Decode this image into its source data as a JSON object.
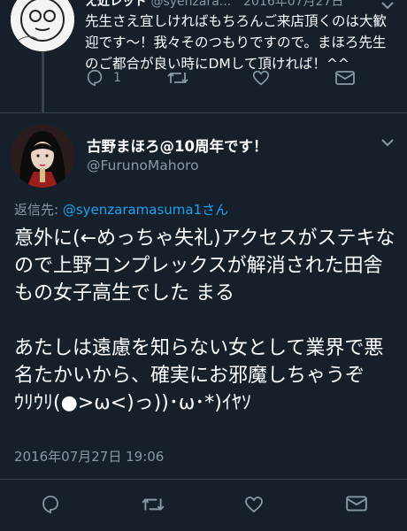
{
  "previous_tweet": {
    "display_name": "え近レッド",
    "handle_date": "@syenzara...　2016年07月27日",
    "text": "先生さえ宜しければもちろんご来店頂くのは大歓迎です〜！我々そのつもりですので。まほろ先生のご都合が良い時にDMして頂ければ！^^",
    "reply_count": "1",
    "icons": [
      "reply-icon",
      "retweet-icon",
      "like-icon",
      "direct-message-icon"
    ]
  },
  "tweet": {
    "display_name": "古野まほろ@10周年です！",
    "handle": "@FurunoMahoro",
    "reply_prefix": "返信先: ",
    "reply_target": "@syenzaramasuma1さん",
    "paragraphs": [
      "意外に(←めっちゃ失礼)アクセスがステキなので上野コンプレックスが解消された田舎もの女子高生でした まる",
      "あたしは遠慮を知らない女として業界で悪名たかいから、確実にお邪魔しちゃうぞ",
      "ｳﾘｳﾘ(●>ω<)っ))･ω･*)ｲﾔｿ"
    ],
    "timestamp": "2016年07月27日 19:06",
    "icons": [
      "reply-icon",
      "retweet-icon",
      "like-icon",
      "direct-message-icon"
    ]
  },
  "colors": {
    "background": "#15202b",
    "text": "#ffffff",
    "secondary": "#8899a6",
    "link": "#1da1f2",
    "divider": "#38444d"
  }
}
